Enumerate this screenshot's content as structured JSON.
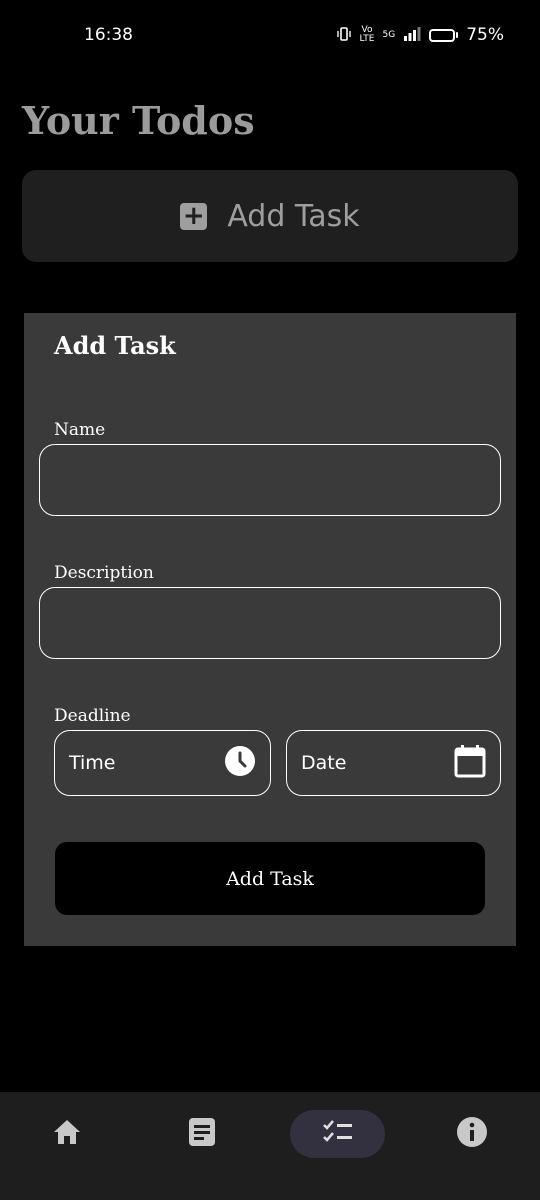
{
  "status_bar": {
    "time": "16:38",
    "network_top": "Vo",
    "network_bottom": "LTE",
    "signal_type": "5G",
    "battery": "75%"
  },
  "page": {
    "title": "Your Todos"
  },
  "add_toggle": {
    "label": "Add Task",
    "icon": "plus-box-icon"
  },
  "form": {
    "title": "Add Task",
    "name_label": "Name",
    "name_value": "",
    "description_label": "Description",
    "description_value": "",
    "deadline_label": "Deadline",
    "time_placeholder": "Time",
    "date_placeholder": "Date",
    "submit_label": "Add Task"
  },
  "bottom_nav": {
    "items": [
      {
        "icon": "home-icon",
        "active": false
      },
      {
        "icon": "notes-icon",
        "active": false
      },
      {
        "icon": "checklist-icon",
        "active": true
      },
      {
        "icon": "info-icon",
        "active": false
      }
    ]
  },
  "colors": {
    "background": "#000000",
    "card": "#3a3a3a",
    "toggle_bg": "#1f1f1f",
    "title_gray": "#9b9b9b",
    "nav_bg": "#1e1e1e",
    "nav_active_pill": "#333040"
  }
}
